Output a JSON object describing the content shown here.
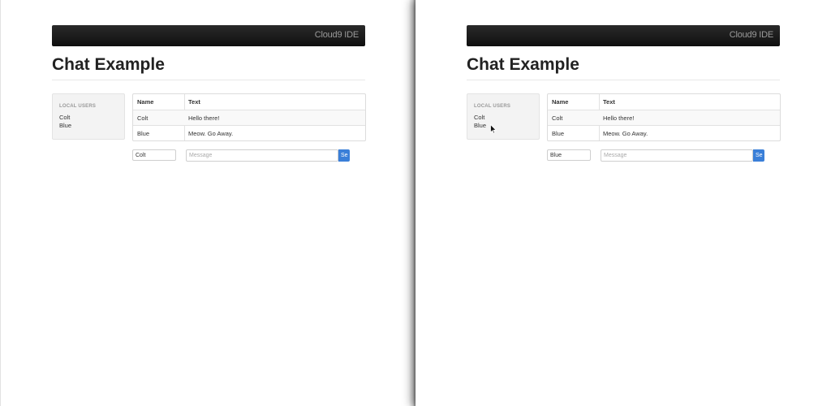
{
  "windows": [
    {
      "navbar": {
        "brand": "Cloud9 IDE"
      },
      "title": "Chat Example",
      "users": {
        "header": "LOCAL USERS",
        "items": [
          "Colt",
          "Blue"
        ]
      },
      "table": {
        "headers": [
          "Name",
          "Text"
        ],
        "rows": [
          [
            "Colt",
            "Hello there!"
          ],
          [
            "Blue",
            "Meow. Go Away."
          ]
        ]
      },
      "form": {
        "name_value": "Colt",
        "message_placeholder": "Message",
        "send_label": "Se"
      }
    },
    {
      "navbar": {
        "brand": "Cloud9 IDE"
      },
      "title": "Chat Example",
      "users": {
        "header": "LOCAL USERS",
        "items": [
          "Colt",
          "Blue"
        ]
      },
      "table": {
        "headers": [
          "Name",
          "Text"
        ],
        "rows": [
          [
            "Colt",
            "Hello there!"
          ],
          [
            "Blue",
            "Meow. Go Away."
          ]
        ]
      },
      "form": {
        "name_value": "Blue",
        "message_placeholder": "Message",
        "send_label": "Se"
      }
    }
  ],
  "colors": {
    "accent": "#3a7fd8",
    "navbar": "#111111",
    "panel": "#f3f3f3"
  }
}
